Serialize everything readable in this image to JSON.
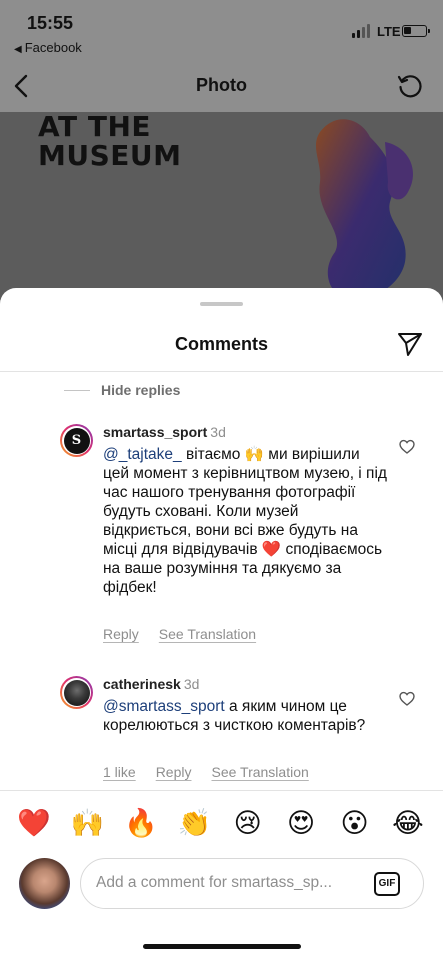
{
  "status_bar": {
    "time": "15:55",
    "back_app": "Facebook",
    "network": "LTE",
    "battery_level": 0.35
  },
  "nav": {
    "title": "Photo"
  },
  "photo": {
    "text_line1": "AT THE",
    "text_line2": "MUSEUM"
  },
  "sheet": {
    "title": "Comments",
    "hide_replies": "Hide replies",
    "comments": [
      {
        "avatar_letter": "S",
        "username": "smartass_sport",
        "time": "3d",
        "mention": "@_tajtake_",
        "text": " вітаємо 🙌 ми вирішили цей момент з керівництвом музею, і під час нашого тренування фотографії будуть сховані. Коли музей відкриється, вони всі вже будуть на місці для відвідувачів ❤️ сподіваємось на ваше розуміння та дякуємо за фідбек!",
        "actions": {
          "reply": "Reply",
          "translate": "See Translation"
        }
      },
      {
        "username": "catherinesk",
        "time": "3d",
        "mention": "@smartass_sport",
        "text": " а яким чином це корелюються з чисткою коментарів?",
        "actions": {
          "likes": "1 like",
          "reply": "Reply",
          "translate": "See Translation"
        }
      }
    ],
    "emojis": [
      "❤️",
      "🙌",
      "🔥",
      "👏",
      "😢",
      "😍",
      "😮",
      "😂"
    ],
    "input": {
      "placeholder": "Add a comment for smartass_sp...",
      "gif_label": "GIF"
    }
  }
}
